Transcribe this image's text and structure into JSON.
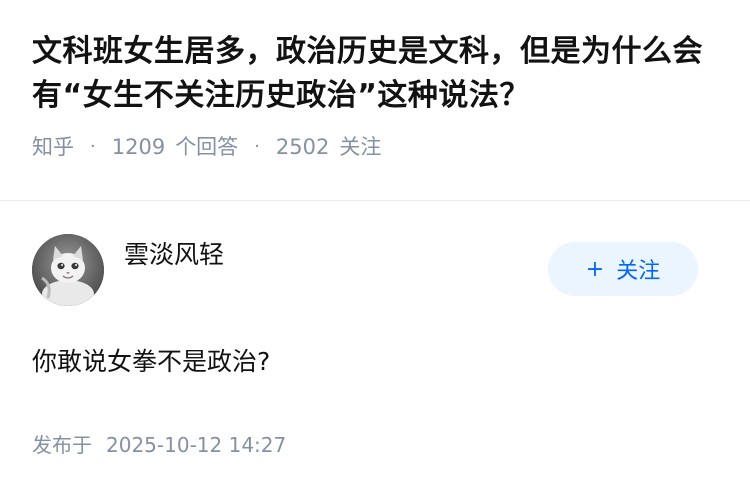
{
  "question": {
    "title": "文科班女生居多，政治历史是文科，但是为什么会有“女生不关注历史政治”这种说法？",
    "source": "知乎",
    "answer_count": "1209",
    "answer_label": "个回答",
    "follower_count": "2502",
    "follower_label": "关注"
  },
  "answer": {
    "author_name": "雲淡风轻",
    "avatar_icon": "cat-avatar",
    "follow_button": "关注",
    "follow_plus": "+",
    "content": "你敢说女拳不是政治?",
    "published_label": "发布于",
    "published_time": "2025-10-12 14:27"
  },
  "colors": {
    "accent": "#0066ff",
    "button_bg": "#ebf5ff",
    "meta": "#8590a6",
    "text": "#121212"
  }
}
